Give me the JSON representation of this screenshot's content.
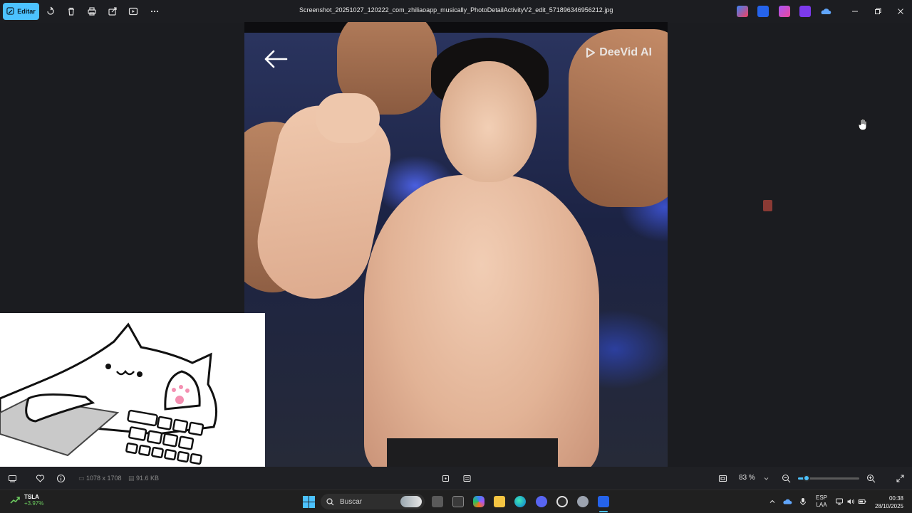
{
  "titlebar": {
    "edit_label": "Editar",
    "file_name": "Screenshot_20251027_120222_com_zhiliaoapp_musically_PhotoDetailActivityV2_edit_571896346956212.jpg"
  },
  "photo": {
    "watermark": "DeeVid AI"
  },
  "statusbar": {
    "dimensions": "1078 x 1708",
    "file_size": "91.6 KB",
    "zoom_percent": "83 %",
    "zoom_level": 0.14
  },
  "taskbar": {
    "stock_symbol": "TSLA",
    "stock_change": "+3.97%",
    "search_placeholder": "Buscar",
    "language": "ESP",
    "layout": "LAA",
    "time": "00:38",
    "date": "28/10/2025"
  },
  "colors": {
    "accent": "#4cc2ff",
    "stock_up": "#6ccb5f"
  },
  "icons": [
    "photo-edit-icon",
    "rotate-icon",
    "delete-icon",
    "print-icon",
    "share-icon",
    "slideshow-icon",
    "more-icon",
    "minimize-icon",
    "maximize-icon",
    "close-icon",
    "back-arrow-icon",
    "deevid-logo-icon",
    "gallery-icon",
    "favorite-icon",
    "info-icon",
    "fit-icon",
    "compare-icon",
    "zoom-out-icon",
    "zoom-in-icon",
    "fullscreen-icon",
    "windows-start-icon",
    "search-icon"
  ]
}
